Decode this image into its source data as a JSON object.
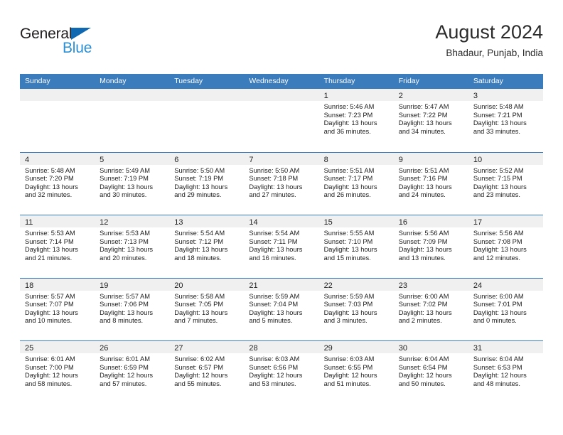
{
  "brand": {
    "name_dark": "General",
    "name_blue": "Blue",
    "accent_dark_blue": "#1068b0",
    "accent_light_blue": "#2b8fd6"
  },
  "header": {
    "title": "August 2024",
    "subtitle": "Bhadaur, Punjab, India"
  },
  "colors": {
    "header_row_bg": "#3b7cbd",
    "day_band_bg": "#f0f0f0",
    "cell_bg": "#ffffff",
    "text": "#1c1c1c"
  },
  "weekdays": [
    "Sunday",
    "Monday",
    "Tuesday",
    "Wednesday",
    "Thursday",
    "Friday",
    "Saturday"
  ],
  "weeks": [
    [
      {
        "day": "",
        "sunrise": "",
        "sunset": "",
        "daylight_1": "",
        "daylight_2": ""
      },
      {
        "day": "",
        "sunrise": "",
        "sunset": "",
        "daylight_1": "",
        "daylight_2": ""
      },
      {
        "day": "",
        "sunrise": "",
        "sunset": "",
        "daylight_1": "",
        "daylight_2": ""
      },
      {
        "day": "",
        "sunrise": "",
        "sunset": "",
        "daylight_1": "",
        "daylight_2": ""
      },
      {
        "day": "1",
        "sunrise": "Sunrise: 5:46 AM",
        "sunset": "Sunset: 7:23 PM",
        "daylight_1": "Daylight: 13 hours",
        "daylight_2": "and 36 minutes."
      },
      {
        "day": "2",
        "sunrise": "Sunrise: 5:47 AM",
        "sunset": "Sunset: 7:22 PM",
        "daylight_1": "Daylight: 13 hours",
        "daylight_2": "and 34 minutes."
      },
      {
        "day": "3",
        "sunrise": "Sunrise: 5:48 AM",
        "sunset": "Sunset: 7:21 PM",
        "daylight_1": "Daylight: 13 hours",
        "daylight_2": "and 33 minutes."
      }
    ],
    [
      {
        "day": "4",
        "sunrise": "Sunrise: 5:48 AM",
        "sunset": "Sunset: 7:20 PM",
        "daylight_1": "Daylight: 13 hours",
        "daylight_2": "and 32 minutes."
      },
      {
        "day": "5",
        "sunrise": "Sunrise: 5:49 AM",
        "sunset": "Sunset: 7:19 PM",
        "daylight_1": "Daylight: 13 hours",
        "daylight_2": "and 30 minutes."
      },
      {
        "day": "6",
        "sunrise": "Sunrise: 5:50 AM",
        "sunset": "Sunset: 7:19 PM",
        "daylight_1": "Daylight: 13 hours",
        "daylight_2": "and 29 minutes."
      },
      {
        "day": "7",
        "sunrise": "Sunrise: 5:50 AM",
        "sunset": "Sunset: 7:18 PM",
        "daylight_1": "Daylight: 13 hours",
        "daylight_2": "and 27 minutes."
      },
      {
        "day": "8",
        "sunrise": "Sunrise: 5:51 AM",
        "sunset": "Sunset: 7:17 PM",
        "daylight_1": "Daylight: 13 hours",
        "daylight_2": "and 26 minutes."
      },
      {
        "day": "9",
        "sunrise": "Sunrise: 5:51 AM",
        "sunset": "Sunset: 7:16 PM",
        "daylight_1": "Daylight: 13 hours",
        "daylight_2": "and 24 minutes."
      },
      {
        "day": "10",
        "sunrise": "Sunrise: 5:52 AM",
        "sunset": "Sunset: 7:15 PM",
        "daylight_1": "Daylight: 13 hours",
        "daylight_2": "and 23 minutes."
      }
    ],
    [
      {
        "day": "11",
        "sunrise": "Sunrise: 5:53 AM",
        "sunset": "Sunset: 7:14 PM",
        "daylight_1": "Daylight: 13 hours",
        "daylight_2": "and 21 minutes."
      },
      {
        "day": "12",
        "sunrise": "Sunrise: 5:53 AM",
        "sunset": "Sunset: 7:13 PM",
        "daylight_1": "Daylight: 13 hours",
        "daylight_2": "and 20 minutes."
      },
      {
        "day": "13",
        "sunrise": "Sunrise: 5:54 AM",
        "sunset": "Sunset: 7:12 PM",
        "daylight_1": "Daylight: 13 hours",
        "daylight_2": "and 18 minutes."
      },
      {
        "day": "14",
        "sunrise": "Sunrise: 5:54 AM",
        "sunset": "Sunset: 7:11 PM",
        "daylight_1": "Daylight: 13 hours",
        "daylight_2": "and 16 minutes."
      },
      {
        "day": "15",
        "sunrise": "Sunrise: 5:55 AM",
        "sunset": "Sunset: 7:10 PM",
        "daylight_1": "Daylight: 13 hours",
        "daylight_2": "and 15 minutes."
      },
      {
        "day": "16",
        "sunrise": "Sunrise: 5:56 AM",
        "sunset": "Sunset: 7:09 PM",
        "daylight_1": "Daylight: 13 hours",
        "daylight_2": "and 13 minutes."
      },
      {
        "day": "17",
        "sunrise": "Sunrise: 5:56 AM",
        "sunset": "Sunset: 7:08 PM",
        "daylight_1": "Daylight: 13 hours",
        "daylight_2": "and 12 minutes."
      }
    ],
    [
      {
        "day": "18",
        "sunrise": "Sunrise: 5:57 AM",
        "sunset": "Sunset: 7:07 PM",
        "daylight_1": "Daylight: 13 hours",
        "daylight_2": "and 10 minutes."
      },
      {
        "day": "19",
        "sunrise": "Sunrise: 5:57 AM",
        "sunset": "Sunset: 7:06 PM",
        "daylight_1": "Daylight: 13 hours",
        "daylight_2": "and 8 minutes."
      },
      {
        "day": "20",
        "sunrise": "Sunrise: 5:58 AM",
        "sunset": "Sunset: 7:05 PM",
        "daylight_1": "Daylight: 13 hours",
        "daylight_2": "and 7 minutes."
      },
      {
        "day": "21",
        "sunrise": "Sunrise: 5:59 AM",
        "sunset": "Sunset: 7:04 PM",
        "daylight_1": "Daylight: 13 hours",
        "daylight_2": "and 5 minutes."
      },
      {
        "day": "22",
        "sunrise": "Sunrise: 5:59 AM",
        "sunset": "Sunset: 7:03 PM",
        "daylight_1": "Daylight: 13 hours",
        "daylight_2": "and 3 minutes."
      },
      {
        "day": "23",
        "sunrise": "Sunrise: 6:00 AM",
        "sunset": "Sunset: 7:02 PM",
        "daylight_1": "Daylight: 13 hours",
        "daylight_2": "and 2 minutes."
      },
      {
        "day": "24",
        "sunrise": "Sunrise: 6:00 AM",
        "sunset": "Sunset: 7:01 PM",
        "daylight_1": "Daylight: 13 hours",
        "daylight_2": "and 0 minutes."
      }
    ],
    [
      {
        "day": "25",
        "sunrise": "Sunrise: 6:01 AM",
        "sunset": "Sunset: 7:00 PM",
        "daylight_1": "Daylight: 12 hours",
        "daylight_2": "and 58 minutes."
      },
      {
        "day": "26",
        "sunrise": "Sunrise: 6:01 AM",
        "sunset": "Sunset: 6:59 PM",
        "daylight_1": "Daylight: 12 hours",
        "daylight_2": "and 57 minutes."
      },
      {
        "day": "27",
        "sunrise": "Sunrise: 6:02 AM",
        "sunset": "Sunset: 6:57 PM",
        "daylight_1": "Daylight: 12 hours",
        "daylight_2": "and 55 minutes."
      },
      {
        "day": "28",
        "sunrise": "Sunrise: 6:03 AM",
        "sunset": "Sunset: 6:56 PM",
        "daylight_1": "Daylight: 12 hours",
        "daylight_2": "and 53 minutes."
      },
      {
        "day": "29",
        "sunrise": "Sunrise: 6:03 AM",
        "sunset": "Sunset: 6:55 PM",
        "daylight_1": "Daylight: 12 hours",
        "daylight_2": "and 51 minutes."
      },
      {
        "day": "30",
        "sunrise": "Sunrise: 6:04 AM",
        "sunset": "Sunset: 6:54 PM",
        "daylight_1": "Daylight: 12 hours",
        "daylight_2": "and 50 minutes."
      },
      {
        "day": "31",
        "sunrise": "Sunrise: 6:04 AM",
        "sunset": "Sunset: 6:53 PM",
        "daylight_1": "Daylight: 12 hours",
        "daylight_2": "and 48 minutes."
      }
    ]
  ]
}
